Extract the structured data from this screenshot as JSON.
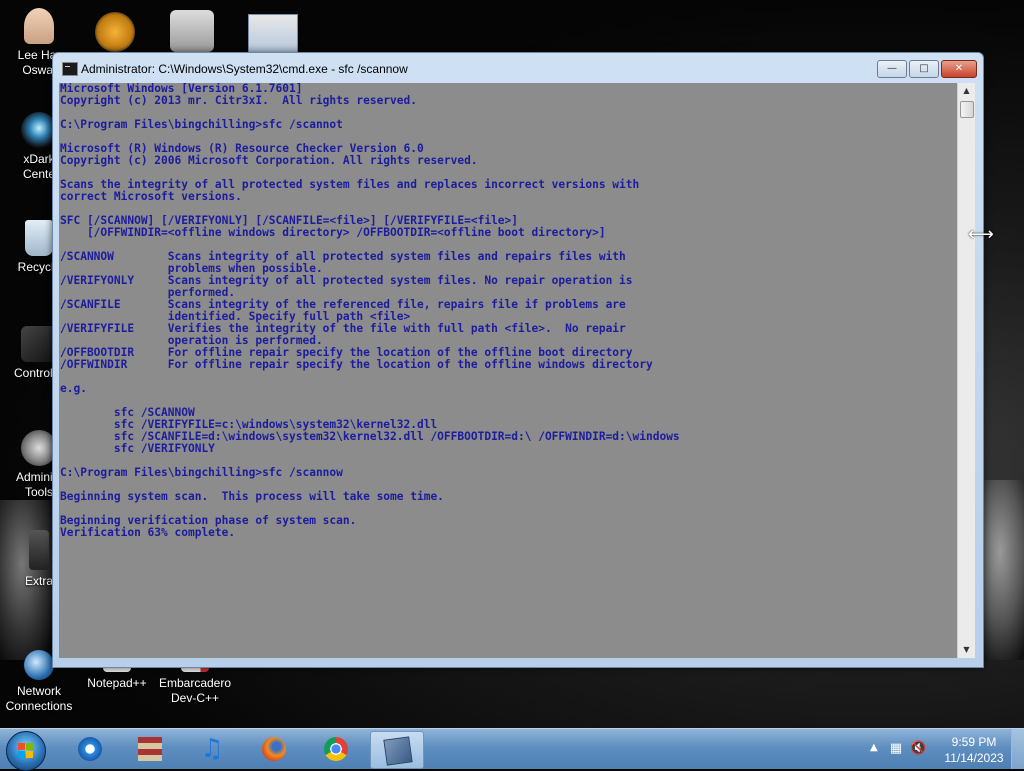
{
  "desktop": {
    "icons": [
      {
        "label_line1": "Lee Har",
        "label_line2": "Oswal",
        "icon": "user-avatar-icon"
      },
      {
        "label_line1": "xDark",
        "label_line2": "Cente",
        "icon": "dark-orb-icon"
      },
      {
        "label_line1": "Recycle",
        "label_line2": "",
        "icon": "recycle-bin-icon"
      },
      {
        "label_line1": "Control P",
        "label_line2": "",
        "icon": "control-panel-icon"
      },
      {
        "label_line1": "Administ",
        "label_line2": "Tools",
        "icon": "admin-tools-icon"
      },
      {
        "label_line1": "Extra",
        "label_line2": "",
        "icon": "extras-icon"
      },
      {
        "label_line1": "Network",
        "label_line2": "Connections",
        "icon": "network-icon"
      },
      {
        "label_line1": "Notepad++",
        "label_line2": "",
        "icon": "notepad-icon"
      },
      {
        "label_line1": "Embarcadero",
        "label_line2": "Dev-C++",
        "icon": "devcpp-icon"
      }
    ]
  },
  "window": {
    "title": "Administrator: C:\\Windows\\System32\\cmd.exe - sfc  /scannow",
    "buttons": {
      "minimize": "—",
      "maximize": "□",
      "close": "✕"
    },
    "console_bg": "#8c8c8c",
    "console_fg": "#1c1c9e",
    "lines": [
      "Microsoft Windows [Version 6.1.7601]",
      "Copyright (c) 2013 mr. Citr3xI.  All rights reserved.",
      "",
      "C:\\Program Files\\bingchilling>sfc /scannot",
      "",
      "Microsoft (R) Windows (R) Resource Checker Version 6.0",
      "Copyright (c) 2006 Microsoft Corporation. All rights reserved.",
      "",
      "Scans the integrity of all protected system files and replaces incorrect versions with",
      "correct Microsoft versions.",
      "",
      "SFC [/SCANNOW] [/VERIFYONLY] [/SCANFILE=<file>] [/VERIFYFILE=<file>]",
      "    [/OFFWINDIR=<offline windows directory> /OFFBOOTDIR=<offline boot directory>]",
      "",
      "/SCANNOW        Scans integrity of all protected system files and repairs files with",
      "                problems when possible.",
      "/VERIFYONLY     Scans integrity of all protected system files. No repair operation is",
      "                performed.",
      "/SCANFILE       Scans integrity of the referenced file, repairs file if problems are",
      "                identified. Specify full path <file>",
      "/VERIFYFILE     Verifies the integrity of the file with full path <file>.  No repair",
      "                operation is performed.",
      "/OFFBOOTDIR     For offline repair specify the location of the offline boot directory",
      "/OFFWINDIR      For offline repair specify the location of the offline windows directory",
      "",
      "e.g.",
      "",
      "        sfc /SCANNOW",
      "        sfc /VERIFYFILE=c:\\windows\\system32\\kernel32.dll",
      "        sfc /SCANFILE=d:\\windows\\system32\\kernel32.dll /OFFBOOTDIR=d:\\ /OFFWINDIR=d:\\windows",
      "        sfc /VERIFYONLY",
      "",
      "C:\\Program Files\\bingchilling>sfc /scannow",
      "",
      "Beginning system scan.  This process will take some time.",
      "",
      "Beginning verification phase of system scan.",
      "Verification 63% complete."
    ]
  },
  "taskbar": {
    "apps": [
      {
        "icon": "internet-explorer-icon",
        "active": false
      },
      {
        "icon": "winrar-icon",
        "active": false
      },
      {
        "icon": "itunes-icon",
        "active": false
      },
      {
        "icon": "firefox-icon",
        "active": false
      },
      {
        "icon": "chrome-icon",
        "active": false
      },
      {
        "icon": "cmd-window-icon",
        "active": true
      }
    ],
    "clock": {
      "time": "9:59 PM",
      "date": "11/14/2023"
    }
  }
}
